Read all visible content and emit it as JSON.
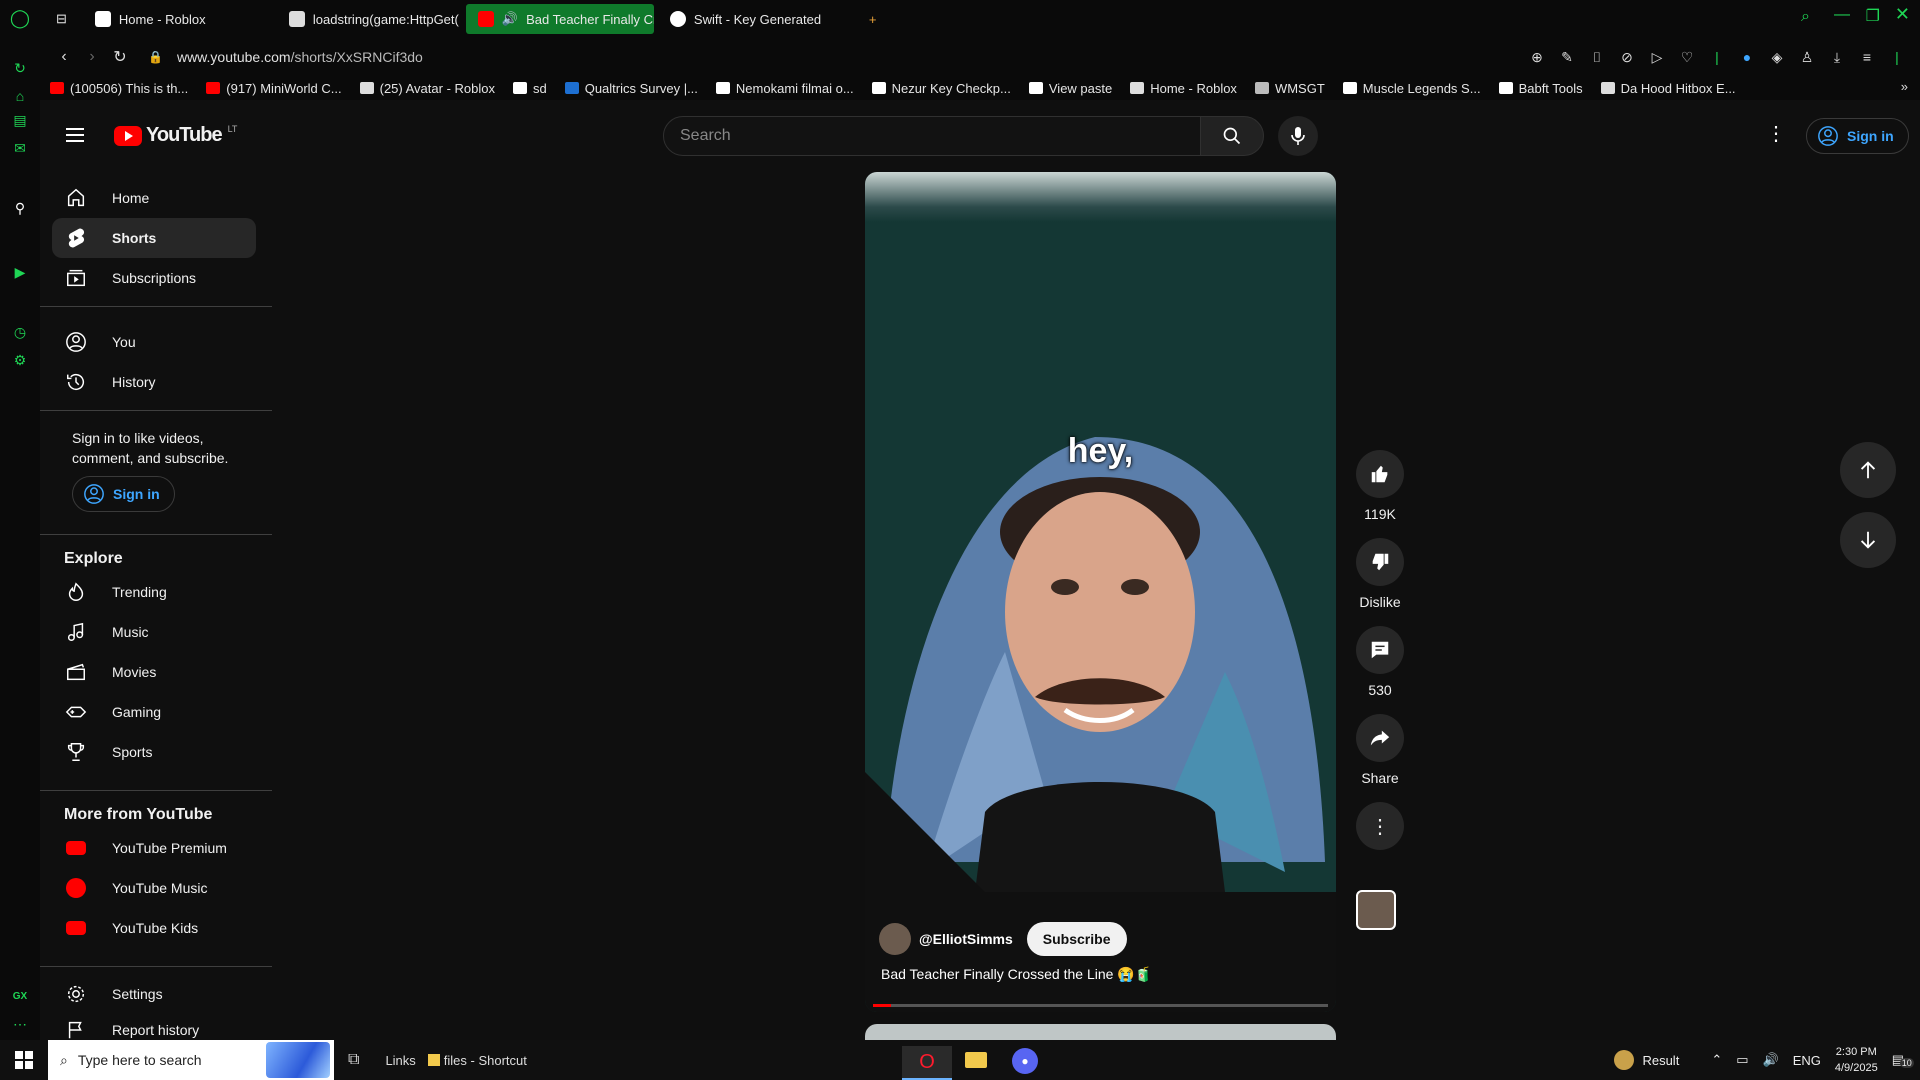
{
  "browser": {
    "tabs": [
      {
        "label": "Home - Roblox",
        "color": "#ffffff",
        "active": false
      },
      {
        "label": "loadstring(game:HttpGet(",
        "color": "#dddddd",
        "active": false
      },
      {
        "label": "Bad Teacher Finally Cr",
        "color": "#ff0000",
        "active": true
      },
      {
        "label": "Swift - Key Generated",
        "color": "#ffffff",
        "active": false
      }
    ],
    "new_tab": "+",
    "url_domain": "www.youtube.com",
    "url_path": "/shorts/XxSRNCif3do",
    "bookmarks": [
      {
        "label": "(100506) This is th...",
        "color": "#ff0000"
      },
      {
        "label": "(917) MiniWorld C...",
        "color": "#ff0000"
      },
      {
        "label": "(25) Avatar - Roblox",
        "color": "#dddddd"
      },
      {
        "label": "sd",
        "color": "#ffffff"
      },
      {
        "label": "Qualtrics Survey |...",
        "color": "#1d6fd1"
      },
      {
        "label": "Nemokami filmai o...",
        "color": "#ffffff"
      },
      {
        "label": "Nezur Key Checkp...",
        "color": "#ffffff"
      },
      {
        "label": "View paste",
        "color": "#ffffff"
      },
      {
        "label": "Home - Roblox",
        "color": "#dddddd"
      },
      {
        "label": "WMSGT",
        "color": "#bbbbbb"
      },
      {
        "label": "Muscle Legends S...",
        "color": "#ffffff"
      },
      {
        "label": "Babft Tools",
        "color": "#ffffff"
      },
      {
        "label": "Da Hood Hitbox E...",
        "color": "#dddddd"
      }
    ],
    "gx_label": "GX"
  },
  "youtube": {
    "logo_text": "YouTube",
    "country": "LT",
    "search_placeholder": "Search",
    "signin_label": "Sign in",
    "sidebar": {
      "main": [
        {
          "label": "Home",
          "icon": "home-icon"
        },
        {
          "label": "Shorts",
          "icon": "shorts-icon"
        },
        {
          "label": "Subscriptions",
          "icon": "subscriptions-icon"
        }
      ],
      "you": [
        {
          "label": "You",
          "icon": "you-icon"
        },
        {
          "label": "History",
          "icon": "history-icon"
        }
      ],
      "signin_msg": "Sign in to like videos, comment, and subscribe.",
      "signin_label": "Sign in",
      "explore_title": "Explore",
      "explore": [
        {
          "label": "Trending",
          "icon": "trending-icon"
        },
        {
          "label": "Music",
          "icon": "music-icon"
        },
        {
          "label": "Movies",
          "icon": "movies-icon"
        },
        {
          "label": "Gaming",
          "icon": "gaming-icon"
        },
        {
          "label": "Sports",
          "icon": "sports-icon"
        }
      ],
      "more_title": "More from YouTube",
      "more": [
        {
          "label": "YouTube Premium"
        },
        {
          "label": "YouTube Music"
        },
        {
          "label": "YouTube Kids"
        }
      ],
      "settings": "Settings",
      "report": "Report history"
    },
    "short": {
      "caption": "hey,",
      "channel": "@ElliotSimms",
      "subscribe": "Subscribe",
      "title": "Bad Teacher Finally Crossed the Line 😭🧃",
      "progress": 0.04,
      "likes": "119K",
      "dislike": "Dislike",
      "comments": "530",
      "share": "Share"
    }
  },
  "taskbar": {
    "search_placeholder": "Type here to search",
    "links": "Links",
    "files": "files - Shortcut",
    "result": "Result",
    "lang": "ENG",
    "time": "2:30 PM",
    "date": "4/9/2025",
    "notif": "10"
  }
}
